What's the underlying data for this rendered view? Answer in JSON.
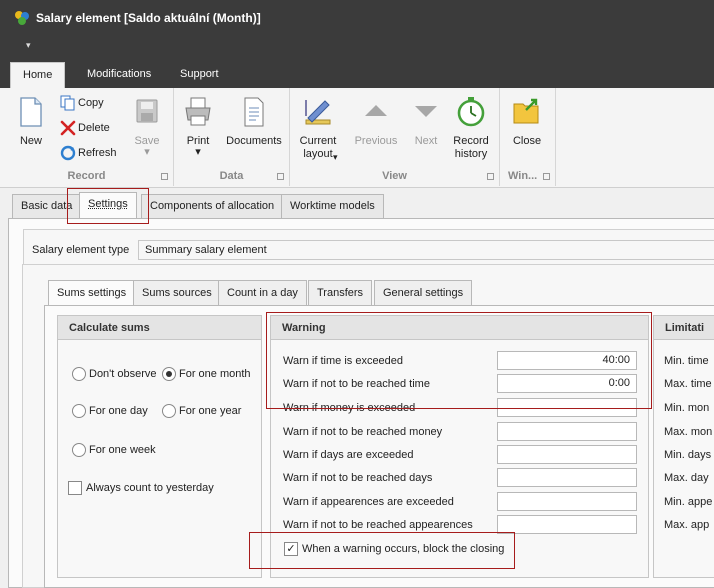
{
  "window": {
    "title": "Salary element [Saldo aktuální (Month)]"
  },
  "ribbon_tabs": [
    "Home",
    "Modifications",
    "Support"
  ],
  "ribbon": {
    "record": {
      "new": "New",
      "copy": "Copy",
      "delete": "Delete",
      "refresh": "Refresh",
      "save": "Save",
      "label": "Record"
    },
    "data": {
      "print": "Print",
      "documents": "Documents",
      "label": "Data"
    },
    "view": {
      "current_layout": "Current layout",
      "previous": "Previous",
      "next": "Next",
      "record_history": "Record history",
      "label": "View"
    },
    "window": {
      "close": "Close",
      "label": "Win..."
    }
  },
  "main_tabs": [
    "Basic data",
    "Settings",
    "Components of allocation",
    "Worktime models"
  ],
  "salary_element_type": {
    "label": "Salary element type",
    "value": "Summary salary element"
  },
  "sub_tabs": [
    "Sums settings",
    "Sums sources",
    "Count in a day",
    "Transfers",
    "General settings"
  ],
  "calculate_sums": {
    "title": "Calculate sums",
    "options": {
      "dont_observe": "Don't observe",
      "one_month": "For one month",
      "one_day": "For one day",
      "one_year": "For one year",
      "one_week": "For one week"
    },
    "selected": "one_month",
    "always_yesterday": "Always count to yesterday"
  },
  "warning": {
    "title": "Warning",
    "rows": [
      {
        "label": "Warn if time is exceeded",
        "value": "40:00"
      },
      {
        "label": "Warn if not to be reached time",
        "value": "0:00"
      },
      {
        "label": "Warn if money is exceeded",
        "value": ""
      },
      {
        "label": "Warn if not to be reached money",
        "value": ""
      },
      {
        "label": "Warn if days are exceeded",
        "value": ""
      },
      {
        "label": "Warn if not to be reached days",
        "value": ""
      },
      {
        "label": "Warn if appearences are exceeded",
        "value": ""
      },
      {
        "label": "Warn if not to be reached appearences",
        "value": ""
      }
    ],
    "block_closing": "When a warning occurs, block the closing",
    "block_checked": true
  },
  "limitation": {
    "title": "Limitati",
    "rows": [
      "Min. time",
      "Max. time",
      "Min. mon",
      "Max. mon",
      "Min. days",
      "Max. day",
      "Min. appe",
      "Max. app"
    ]
  }
}
